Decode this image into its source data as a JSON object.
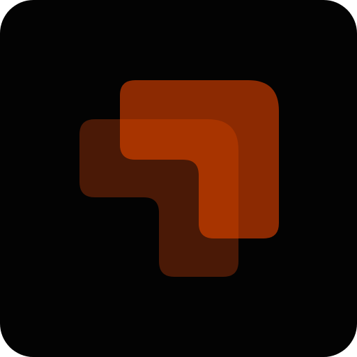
{
  "icon": {
    "name": "layered-l-shapes-logo",
    "background_color": "#030303",
    "back_shape_color": "#4a1906",
    "front_shape_color": "#8c2a02",
    "overlap_color": "#a83400"
  }
}
